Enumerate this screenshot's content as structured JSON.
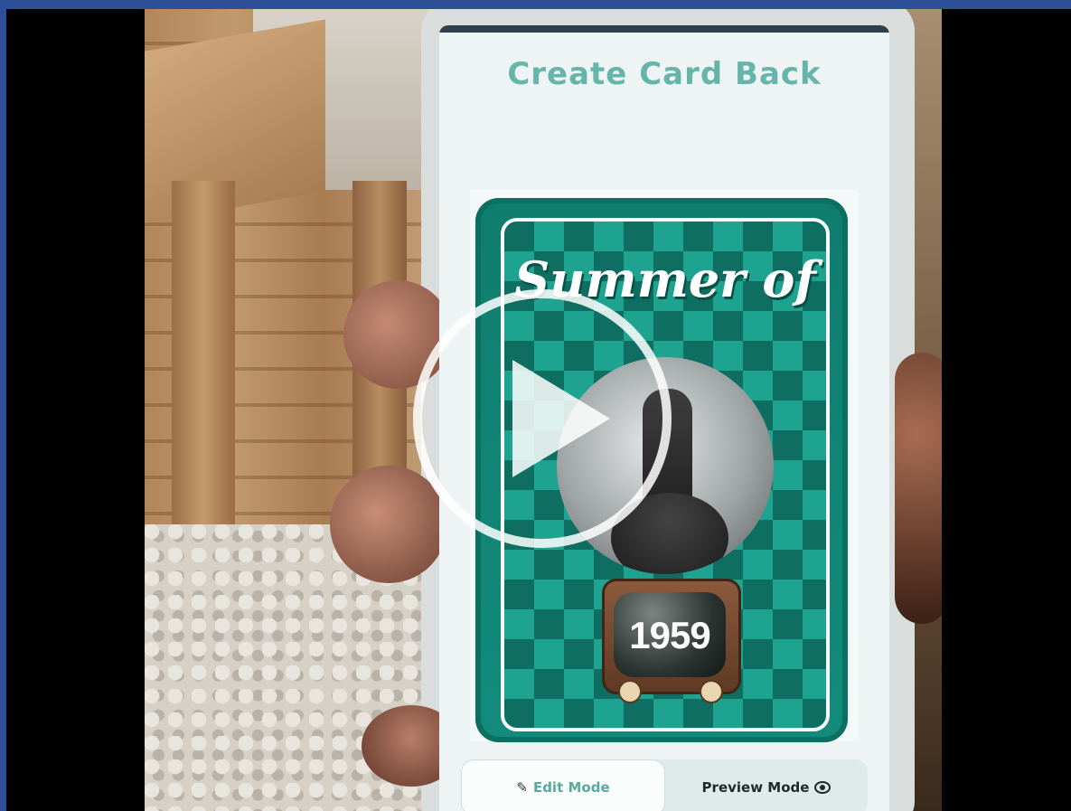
{
  "app": {
    "screen_title": "Create Card Back"
  },
  "card": {
    "title": "Summer of",
    "year": "1959"
  },
  "mode_toggle": {
    "edit_label": "Edit Mode",
    "preview_label": "Preview Mode",
    "active": "edit"
  },
  "icons": {
    "edit": "pencil-icon",
    "preview": "eye-icon",
    "play": "play-icon"
  },
  "colors": {
    "accent": "#66b5aa",
    "card_teal": "#0f7d6e",
    "frame_blue": "#2d4f98"
  }
}
